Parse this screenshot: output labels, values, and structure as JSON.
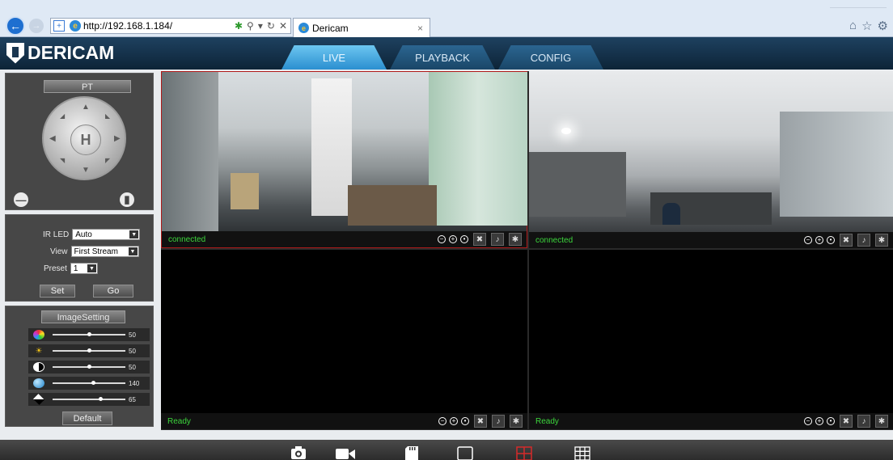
{
  "browser": {
    "url": "http://192.168.1.184/",
    "tab_title": "Dericam",
    "tab_close": "×",
    "right_icons": [
      "home-icon",
      "star-icon",
      "gear-icon"
    ]
  },
  "app": {
    "logo_text": "DERICAM",
    "nav_tabs": [
      {
        "label": "LIVE",
        "active": true
      },
      {
        "label": "PLAYBACK",
        "active": false
      },
      {
        "label": "CONFIG",
        "active": false
      }
    ]
  },
  "ptz_panel": {
    "title": "PT",
    "home_label": "H"
  },
  "control_panel": {
    "ir_led_label": "IR LED",
    "ir_led_value": "Auto",
    "view_label": "View",
    "view_value": "First Stream",
    "preset_label": "Preset",
    "preset_value": "1",
    "set_button": "Set",
    "go_button": "Go"
  },
  "image_panel": {
    "title": "ImageSetting",
    "sliders": [
      {
        "name": "hue",
        "icon": "color-wheel-icon",
        "value": "50",
        "level": 0.5
      },
      {
        "name": "brightness",
        "icon": "sun-icon",
        "value": "50",
        "level": 0.5
      },
      {
        "name": "contrast",
        "icon": "contrast-icon",
        "value": "50",
        "level": 0.5
      },
      {
        "name": "saturation",
        "icon": "saturation-icon",
        "value": "140",
        "level": 0.55
      },
      {
        "name": "sharpness",
        "icon": "sharpness-icon",
        "value": "65",
        "level": 0.65
      }
    ],
    "default_button": "Default"
  },
  "video_cells": [
    {
      "status": "connected",
      "has_feed": true,
      "selected": true
    },
    {
      "status": "connected",
      "has_feed": true,
      "selected": false
    },
    {
      "status": "Ready",
      "has_feed": false,
      "selected": false
    },
    {
      "status": "Ready",
      "has_feed": false,
      "selected": false
    }
  ],
  "bottom_toolbar": [
    "snapshot-icon",
    "record-icon",
    "sd-card-icon",
    "single-view-icon",
    "quad-view-icon",
    "nine-view-icon"
  ],
  "colors": {
    "status_green": "#3cd63c",
    "active_tab": "#2b8fd0",
    "selected_border": "#b01a1a",
    "quad_icon": "#d62a2a"
  }
}
